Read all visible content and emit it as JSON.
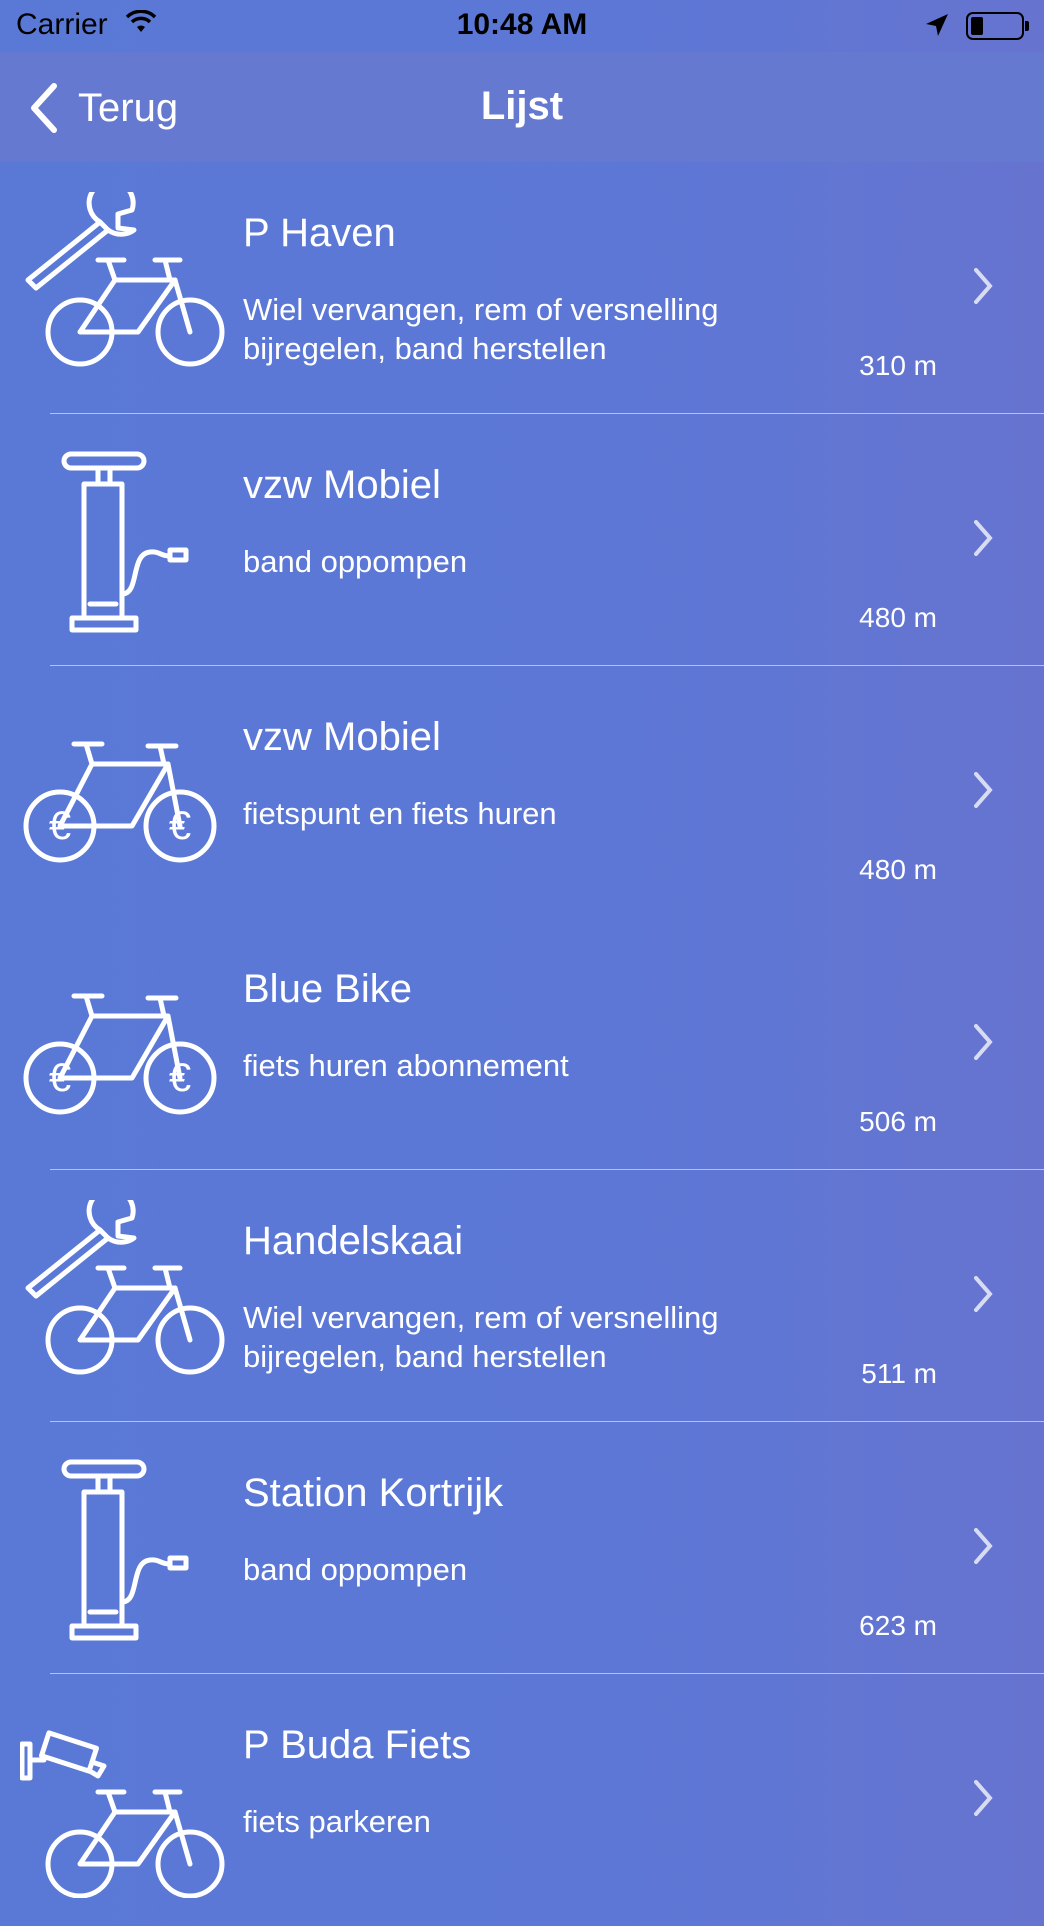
{
  "status_bar": {
    "carrier": "Carrier",
    "time": "10:48 AM",
    "wifi_icon": "wifi-icon",
    "location_icon": "location-arrow-icon",
    "battery_icon": "battery-icon"
  },
  "nav": {
    "back_label": "Terug",
    "title": "Lijst"
  },
  "colors": {
    "background": "#5a79d6",
    "navbar": "#6479cf",
    "text": "#ffffff"
  },
  "items": [
    {
      "icon": "bike-repair-icon",
      "title": "P Haven",
      "desc": "Wiel vervangen, rem of versnelling bijregelen, band herstellen",
      "distance": "310 m"
    },
    {
      "icon": "bike-pump-icon",
      "title": "vzw Mobiel",
      "desc": "band oppompen",
      "distance": "480 m"
    },
    {
      "icon": "bike-rental-icon",
      "title": "vzw Mobiel",
      "desc": "fietspunt en fiets huren",
      "distance": "480 m"
    },
    {
      "icon": "bike-rental-icon",
      "title": "Blue Bike",
      "desc": "fiets huren abonnement",
      "distance": "506 m"
    },
    {
      "icon": "bike-repair-icon",
      "title": "Handelskaai",
      "desc": "Wiel vervangen, rem of versnelling bijregelen, band herstellen",
      "distance": "511 m"
    },
    {
      "icon": "bike-pump-icon",
      "title": "Station Kortrijk",
      "desc": "band oppompen",
      "distance": "623 m"
    },
    {
      "icon": "bike-parking-camera-icon",
      "title": "P Buda Fiets",
      "desc": "fiets parkeren",
      "distance": ""
    }
  ]
}
